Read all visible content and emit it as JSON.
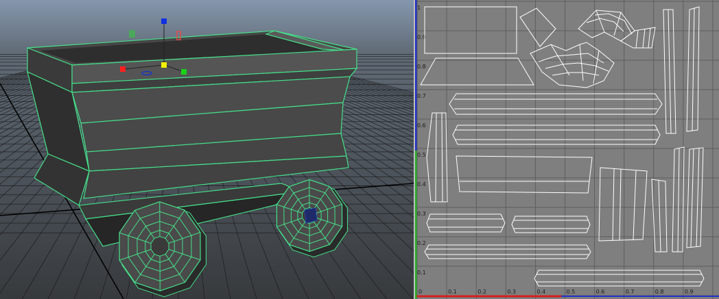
{
  "viewport3d": {
    "background_top": "#8597ad",
    "background_bottom": "#373a3d",
    "grid_color": "#151515",
    "model_fill": "#474747",
    "wireframe_color": "#45e08a",
    "manipulator_colors": {
      "x": "#ff1f1f",
      "y": "#18d418",
      "z": "#1030e0",
      "center": "#f3f000",
      "scale_y": "#4aa75b",
      "rotate": "#e24c4c"
    },
    "model_name": "mine-cart",
    "wheel_count": 2
  },
  "uv_editor": {
    "background": "#7f7f7f",
    "grid_color": "#5e5e5e",
    "shell_color": "#ffffff",
    "u_axis_color": "#d42020",
    "v_axis_color": "#2432c8",
    "origin_axis_color": "#28b028",
    "u_ticks": [
      "0",
      "0.1",
      "0.2",
      "0.3",
      "0.4",
      "0.5",
      "0.6",
      "0.7",
      "0.8",
      "0.9"
    ],
    "v_ticks": [
      "0.1",
      "0.2",
      "0.3",
      "0.4",
      "0.5",
      "0.6",
      "0.7",
      "0.8",
      "0.9",
      "1"
    ]
  }
}
